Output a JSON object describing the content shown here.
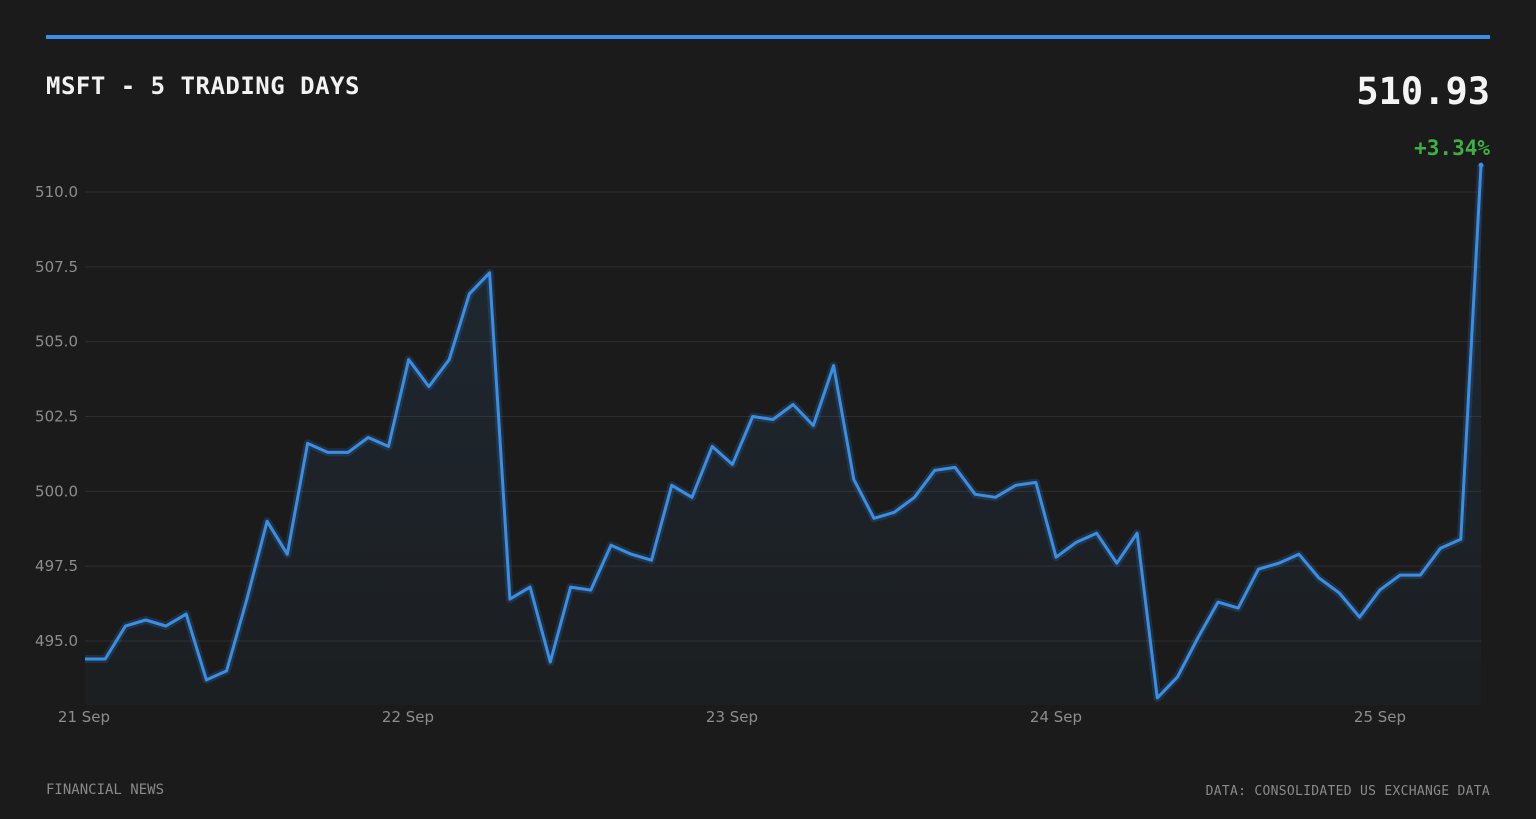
{
  "header": {
    "title": "MSFT - 5 TRADING DAYS",
    "price": "510.93",
    "change": "+3.34%"
  },
  "footer": {
    "left": "FINANCIAL NEWS",
    "right": "DATA: CONSOLIDATED US EXCHANGE DATA"
  },
  "colors": {
    "background": "#1b1b1b",
    "accent": "#3a8ee6",
    "positive": "#3cb043",
    "grid": "#2e2e2e"
  },
  "chart_data": {
    "type": "area",
    "title": "MSFT - 5 TRADING DAYS",
    "xlabel": "",
    "ylabel": "",
    "ylim": [
      493.2,
      510.9
    ],
    "yticks": [
      495.0,
      497.5,
      500.0,
      502.5,
      505.0,
      507.5,
      510.0
    ],
    "ytick_labels": [
      "495.0",
      "497.5",
      "500.0",
      "502.5",
      "505.0",
      "507.5",
      "510.0"
    ],
    "xticks": [
      "21 Sep",
      "22 Sep",
      "23 Sep",
      "24 Sep",
      "25 Sep"
    ],
    "grid": true,
    "series": [
      {
        "values": [
          494.4,
          494.4,
          495.5,
          495.7,
          495.5,
          495.9,
          493.7,
          494.0,
          496.4,
          499.0,
          497.9,
          501.6,
          501.3,
          501.3,
          501.8,
          501.5,
          504.4,
          503.5,
          504.4,
          506.6,
          507.3,
          496.4,
          496.8,
          494.3,
          496.8,
          496.7,
          498.2,
          497.9,
          497.7,
          500.2,
          499.8,
          501.5,
          500.9,
          502.5,
          502.4,
          502.9,
          502.2,
          504.2,
          500.4,
          499.1,
          499.3,
          499.8,
          500.7,
          500.8,
          499.9,
          499.8,
          500.2,
          500.3,
          497.8,
          498.3,
          498.6,
          497.6,
          498.6,
          493.1,
          493.8,
          495.1,
          496.3,
          496.1,
          497.4,
          497.6,
          497.9,
          497.1,
          496.6,
          495.8,
          496.7,
          497.2,
          497.2,
          498.1,
          498.4,
          510.9
        ]
      }
    ]
  }
}
